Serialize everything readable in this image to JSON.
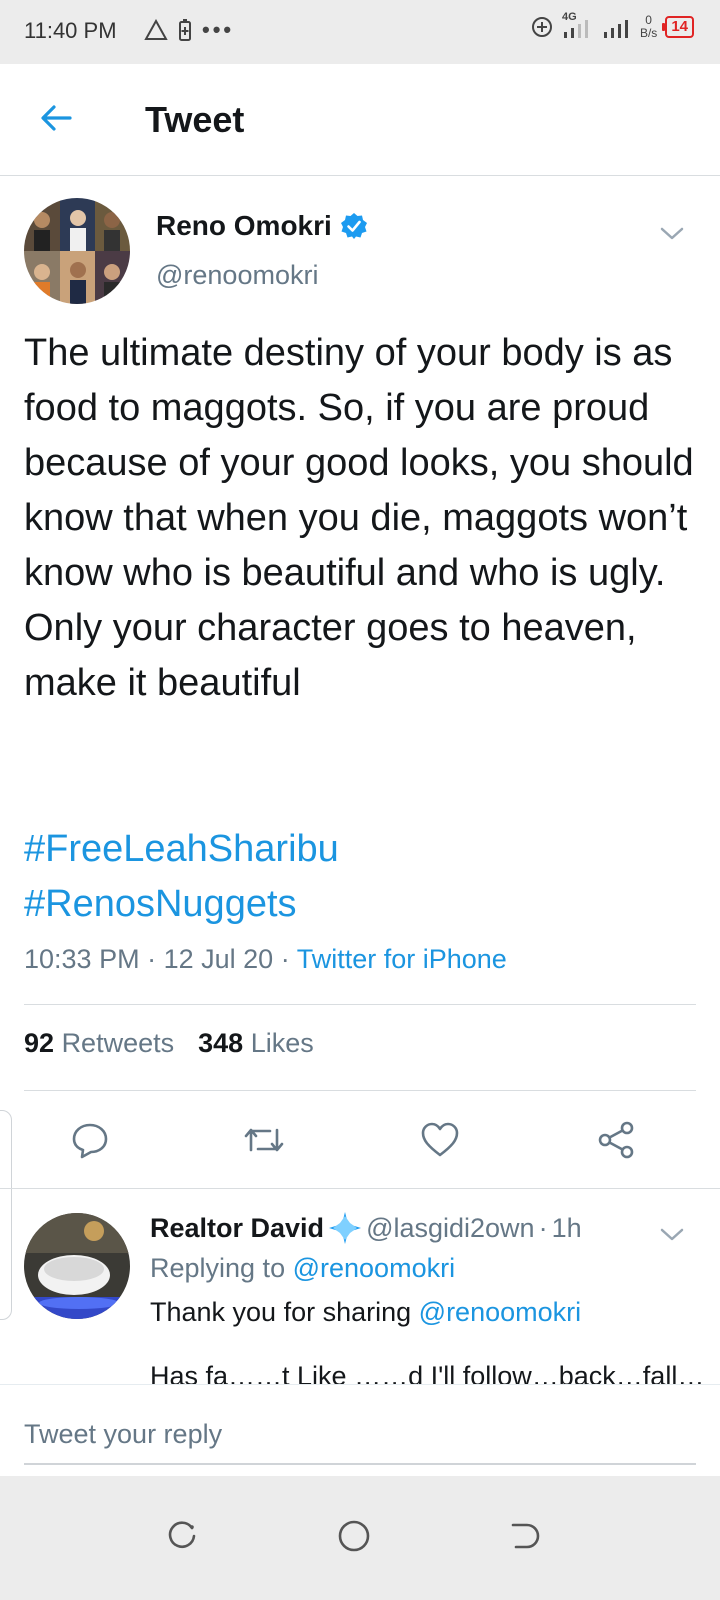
{
  "status_bar": {
    "time": "11:40 PM",
    "network": "4G",
    "speed_value": "0",
    "speed_unit": "B/s",
    "battery": "14"
  },
  "header": {
    "title": "Tweet"
  },
  "tweet": {
    "author_name": "Reno Omokri",
    "author_handle": "@renoomokri",
    "verified": true,
    "text": "The ultimate destiny of your body is as food to maggots. So, if you are proud because of your good looks, you should know that when you die, maggots won’t know who is beautiful and who is ugly. Only your character goes to heaven, make it beautiful",
    "hashtags": [
      "#FreeLeahSharibu",
      "#RenosNuggets"
    ],
    "time": "10:33 PM",
    "date": "12 Jul 20",
    "source": "Twitter for iPhone",
    "retweets_count": "92",
    "retweets_label": "Retweets",
    "likes_count": "348",
    "likes_label": "Likes"
  },
  "reply": {
    "name": "Realtor David",
    "handle": "@lasgidi2own",
    "age": "1h",
    "replying_label": "Replying to",
    "replying_to": "@renoomokri",
    "text": "Thank you for sharing",
    "mention": "@renoomokri",
    "cut_off_text": "Has fa……t Like ……d I'll follow…back…fall…"
  },
  "compose": {
    "placeholder": "Tweet your reply"
  },
  "colors": {
    "accent": "#1b95e0",
    "secondary_text": "#657786",
    "battery_alert": "#e02424"
  }
}
